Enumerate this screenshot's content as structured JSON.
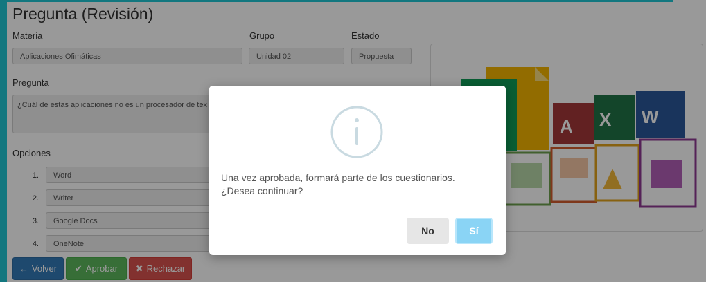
{
  "page": {
    "title": "Pregunta (Revisión)",
    "labels": {
      "materia": "Materia",
      "grupo": "Grupo",
      "estado": "Estado",
      "pregunta": "Pregunta",
      "opciones": "Opciones"
    },
    "fields": {
      "materia": "Aplicaciones Ofimáticas",
      "grupo": "Unidad 02",
      "estado": "Propuesta",
      "pregunta": "¿Cuál de estas aplicaciones no es un procesador de tex"
    },
    "options": [
      {
        "num": "1.",
        "text": "Word"
      },
      {
        "num": "2.",
        "text": "Writer"
      },
      {
        "num": "3.",
        "text": "Google Docs"
      },
      {
        "num": "4.",
        "text": "OneNote"
      }
    ],
    "buttons": {
      "volver": "Volver",
      "aprobar": "Aprobar",
      "rechazar": "Rechazar"
    }
  },
  "dialog": {
    "icon": "info-icon",
    "message_line1": "Una vez aprobada, formará parte de los cuestionarios.",
    "message_line2": "¿Desea continuar?",
    "no_label": "No",
    "si_label": "Sí"
  },
  "colors": {
    "accent_frame": "#1fc7d4",
    "volver": "#337ab7",
    "aprobar": "#5cb85c",
    "rechazar": "#d9534f",
    "confirm": "#8ad4f5"
  }
}
